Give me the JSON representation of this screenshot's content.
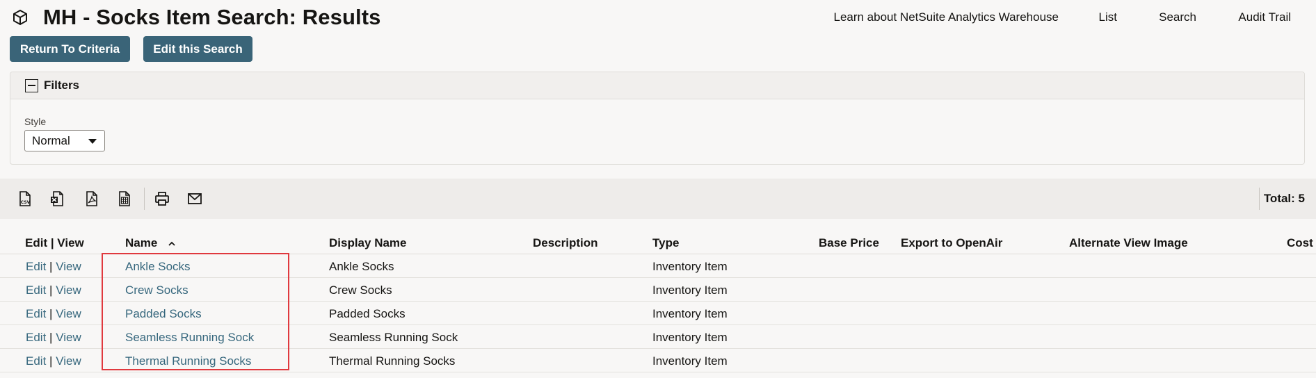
{
  "header": {
    "title": "MH - Socks Item Search: Results",
    "links": [
      "Learn about NetSuite Analytics Warehouse",
      "List",
      "Search",
      "Audit Trail"
    ]
  },
  "buttons": {
    "return": "Return To Criteria",
    "edit_search": "Edit this Search"
  },
  "filters": {
    "title": "Filters",
    "style_label": "Style",
    "style_value": "Normal"
  },
  "toolbar": {
    "icons": [
      "csv-export-icon",
      "excel-export-icon",
      "pdf-export-icon",
      "spreadsheet-export-icon",
      "print-icon",
      "email-icon"
    ],
    "total": "Total: 5"
  },
  "table": {
    "columns": [
      "Edit | View",
      "Name",
      "Display Name",
      "Description",
      "Type",
      "Base Price",
      "Export to OpenAir",
      "Alternate View Image",
      "Cost"
    ],
    "sort_indicator": "^",
    "edit_label": "Edit",
    "separator": "|",
    "view_label": "View",
    "rows": [
      {
        "name": "Ankle Socks",
        "display_name": "Ankle Socks",
        "type": "Inventory Item"
      },
      {
        "name": "Crew Socks",
        "display_name": "Crew Socks",
        "type": "Inventory Item"
      },
      {
        "name": "Padded Socks",
        "display_name": "Padded Socks",
        "type": "Inventory Item"
      },
      {
        "name": "Seamless Running Sock",
        "display_name": "Seamless Running Sock",
        "type": "Inventory Item"
      },
      {
        "name": "Thermal Running Socks",
        "display_name": "Thermal Running Socks",
        "type": "Inventory Item"
      }
    ]
  },
  "colors": {
    "button": "#3a6478",
    "link": "#36677d",
    "highlight": "#e0393e"
  }
}
